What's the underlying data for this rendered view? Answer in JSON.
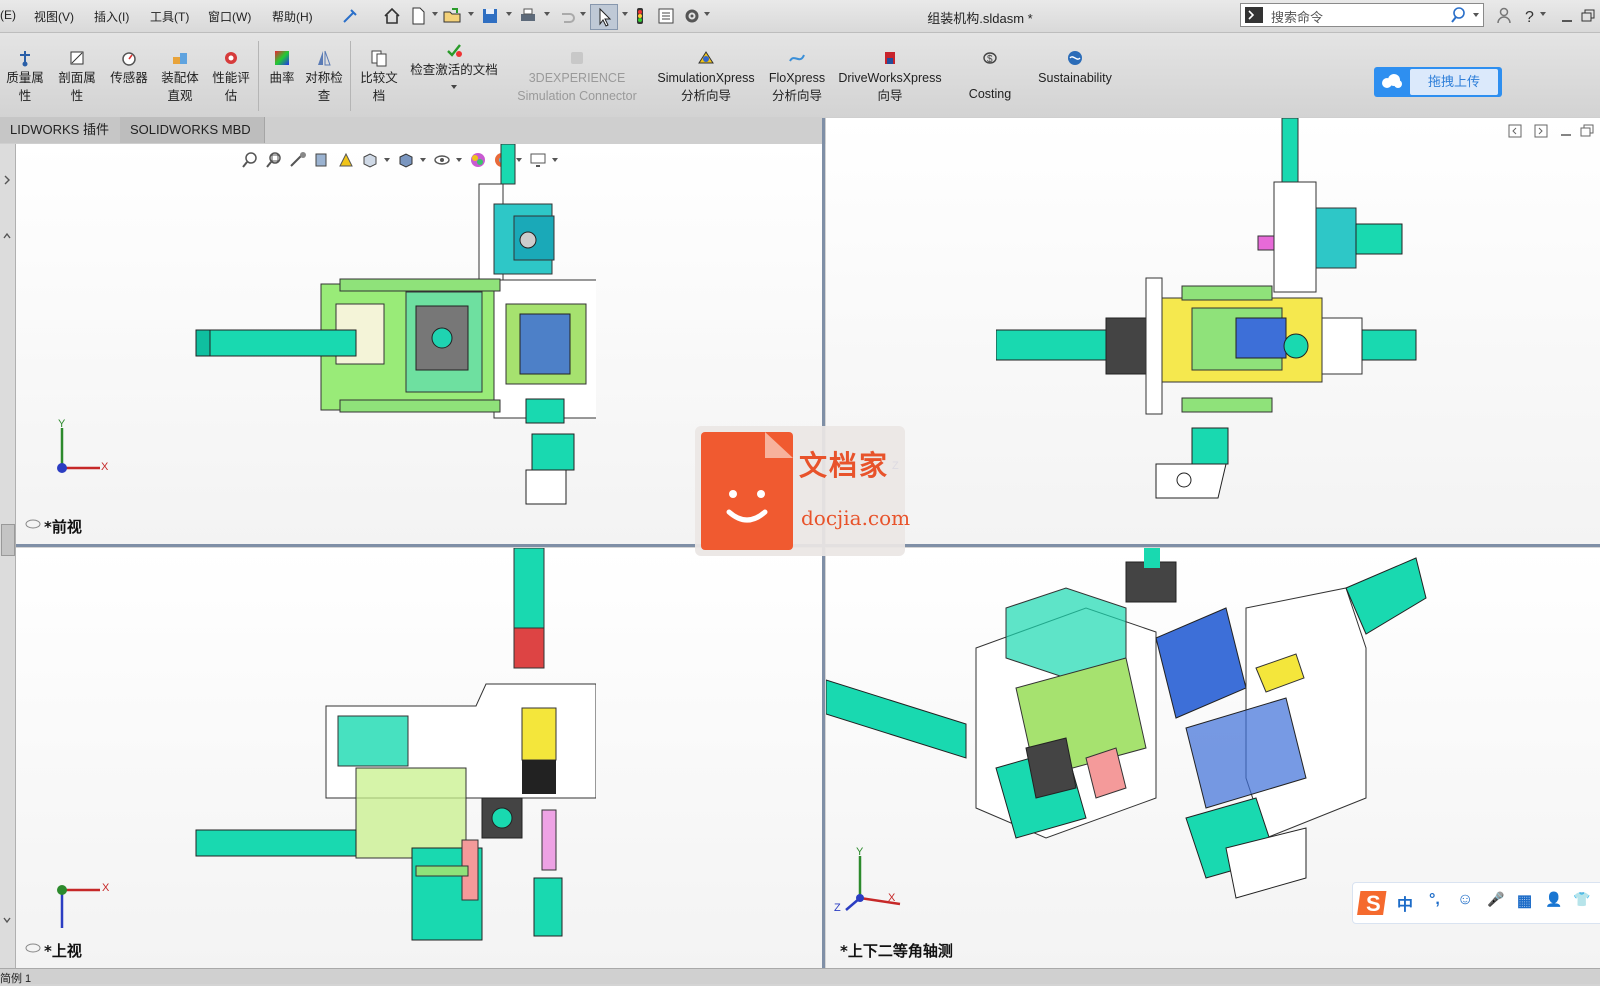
{
  "window": {
    "document_title": "组装机构.sldasm *",
    "search_placeholder": "搜索命令"
  },
  "menu": {
    "items": [
      "(E)",
      "视图(V)",
      "插入(I)",
      "工具(T)",
      "窗口(W)",
      "帮助(H)"
    ]
  },
  "commands": [
    {
      "label": "质量属\n性",
      "icon": "mass-properties-icon"
    },
    {
      "label": "剖面属\n性",
      "icon": "section-properties-icon"
    },
    {
      "label": "传感器",
      "icon": "sensor-icon"
    },
    {
      "label": "装配体\n直观",
      "icon": "assembly-visualization-icon"
    },
    {
      "label": "性能评\n估",
      "icon": "performance-evaluation-icon"
    },
    {
      "label": "曲率",
      "icon": "curvature-icon"
    },
    {
      "label": "对称检\n查",
      "icon": "symmetry-check-icon"
    },
    {
      "label": "比较文\n档",
      "icon": "compare-documents-icon"
    },
    {
      "label": "检查激活的文档",
      "icon": "check-active-document-icon"
    },
    {
      "label": "3DEXPERIENCE\nSimulation Connector",
      "icon": "3dexperience-icon",
      "disabled": true
    },
    {
      "label": "SimulationXpress\n分析向导",
      "icon": "simulationxpress-icon"
    },
    {
      "label": "FloXpress\n分析向导",
      "icon": "floxpress-icon"
    },
    {
      "label": "DriveWorksXpress\n向导",
      "icon": "driveworksxpress-icon"
    },
    {
      "label": "Costing",
      "icon": "costing-icon"
    },
    {
      "label": "Sustainability",
      "icon": "sustainability-icon"
    }
  ],
  "cloud_button": "拖拽上传",
  "tabs": [
    "LIDWORKS 插件",
    "SOLIDWORKS MBD"
  ],
  "viewports": {
    "front": {
      "label": "*前视"
    },
    "top": {
      "label": "*上视"
    },
    "iso": {
      "label": "*上下二等角轴测"
    }
  },
  "axes": {
    "x": "X",
    "y": "Y",
    "z": "Z"
  },
  "watermark": {
    "title": "文档家",
    "url": "docjia.com"
  },
  "ime": {
    "items": [
      "中",
      "°,",
      "☺",
      "🎤",
      "▦",
      "👤",
      "👕"
    ]
  },
  "status": {
    "text": "简例 1"
  },
  "colors": {
    "part_teal": "#19d9b0",
    "part_green": "#8fe27a",
    "part_blue": "#3d6fd8",
    "part_yellow": "#f4e63b",
    "brand_orange": "#e8532b",
    "cloud_blue": "#2e8ff0"
  }
}
